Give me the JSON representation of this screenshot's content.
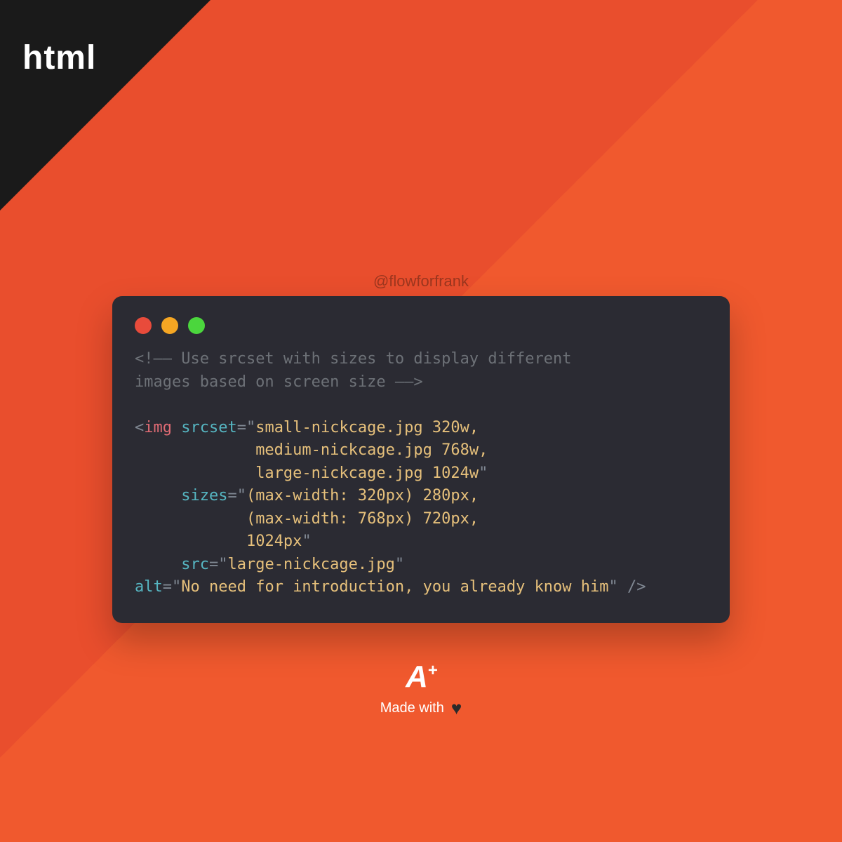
{
  "corner_label": "html",
  "handle": "@flowforfrank",
  "code": {
    "comment_open": "<!——",
    "comment_text": " Use srcset with sizes to display different\nimages based on screen size ",
    "comment_close": "——>",
    "lt": "<",
    "tag": "img",
    "attr_srcset": "srcset",
    "val_srcset_l1": "small-nickcage.jpg 320w,",
    "val_srcset_l2": "medium-nickcage.jpg 768w,",
    "val_srcset_l3": "large-nickcage.jpg 1024w",
    "attr_sizes": "sizes",
    "val_sizes_l1": "(max-width: 320px) 280px,",
    "val_sizes_l2": "(max-width: 768px) 720px,",
    "val_sizes_l3": "1024px",
    "attr_src": "src",
    "val_src": "large-nickcage.jpg",
    "attr_alt": "alt",
    "val_alt": "No need for introduction, you already know him",
    "eq": "=",
    "q": "\"",
    "selfclose": " />"
  },
  "footer": {
    "logo_a": "A",
    "logo_plus": "+",
    "made_text": "Made with"
  }
}
